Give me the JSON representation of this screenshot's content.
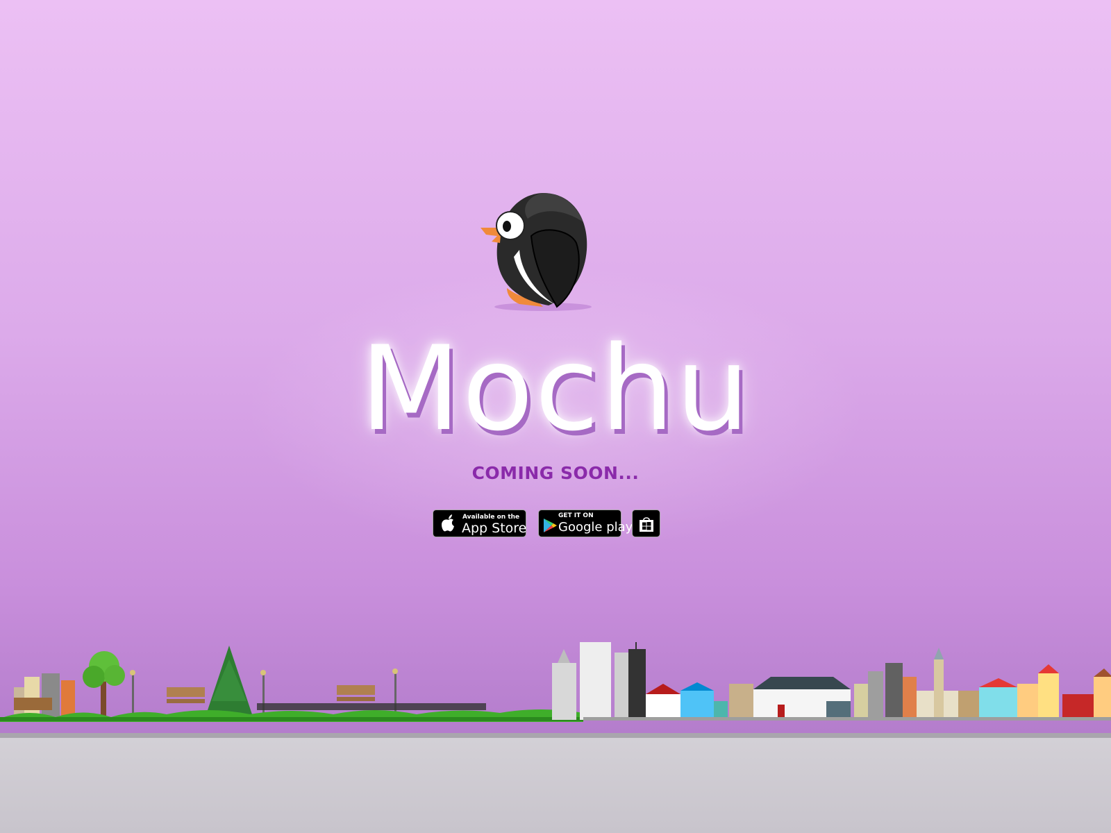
{
  "brand": {
    "name": "Mochu",
    "tagline": "COMING SOON..."
  },
  "stores": {
    "apple": {
      "small": "Available on the",
      "big": "App Store"
    },
    "google": {
      "small": "GET IT ON",
      "big": "Google play"
    },
    "windows": {
      "icon": "windows-store-icon"
    }
  },
  "colors": {
    "tagline": "#8a2aaa",
    "background_top": "#ecc0f4",
    "background_bottom": "#b47dcc"
  },
  "icons": [
    "penguin-mascot",
    "apple-icon",
    "google-play-icon",
    "windows-store-icon"
  ]
}
